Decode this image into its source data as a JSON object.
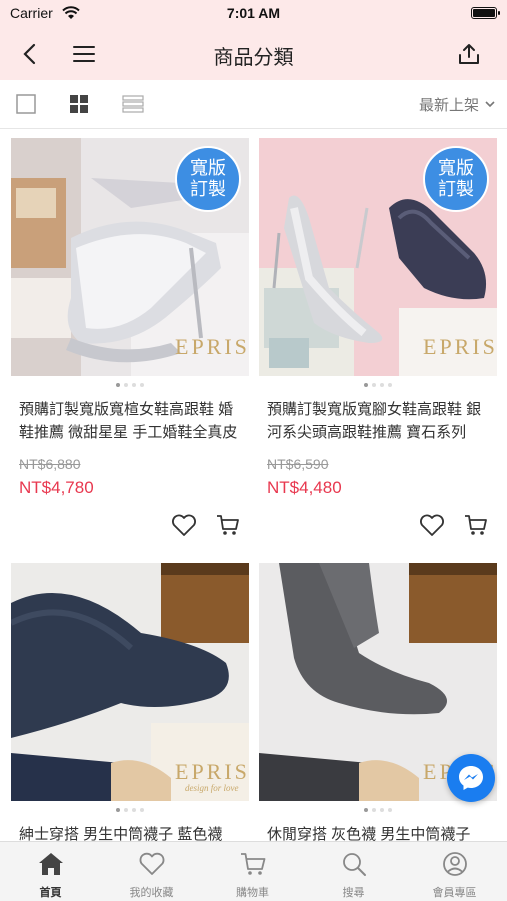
{
  "status_bar": {
    "carrier": "Carrier",
    "time": "7:01 AM"
  },
  "nav": {
    "title": "商品分類",
    "back_icon": "chevron-left-icon",
    "menu_icon": "hamburger-icon",
    "share_icon": "share-icon"
  },
  "toolbar": {
    "sort_label": "最新上架",
    "views": [
      "single-view-icon",
      "grid-view-icon",
      "list-view-icon"
    ],
    "active_view": "grid"
  },
  "products": [
    {
      "name": "預購訂製寬版寬楦女鞋高跟鞋 婚鞋推薦 微甜星星 手工婚鞋全真皮",
      "badge": [
        "寬版",
        "訂製"
      ],
      "original_price": "NT$6,880",
      "sale_price": "NT$4,780",
      "brand": "EPRIS"
    },
    {
      "name": "預購訂製寬版寬腳女鞋高跟鞋 銀河系尖頭高跟鞋推薦 寶石系列",
      "badge": [
        "寬版",
        "訂製"
      ],
      "original_price": "NT$6,590",
      "sale_price": "NT$4,480",
      "brand": "EPRIS"
    },
    {
      "name": "紳士穿搭 男生中筒襪子 藍色襪",
      "brand": "EPRIS",
      "brand_sub": "design for love"
    },
    {
      "name": "休閒穿搭 灰色襪 男生中筒襪子",
      "brand": "EPRIS"
    }
  ],
  "tabbar": [
    {
      "label": "首頁",
      "icon": "home-icon",
      "active": true
    },
    {
      "label": "我的收藏",
      "icon": "heart-icon",
      "active": false
    },
    {
      "label": "購物車",
      "icon": "cart-icon",
      "active": false
    },
    {
      "label": "搜尋",
      "icon": "search-icon",
      "active": false
    },
    {
      "label": "會員專區",
      "icon": "user-icon",
      "active": false
    }
  ],
  "colors": {
    "header_bg": "#fde9e9",
    "sale_price": "#e8384f",
    "badge": "#3d8ee3",
    "messenger": "#1a7df0"
  }
}
